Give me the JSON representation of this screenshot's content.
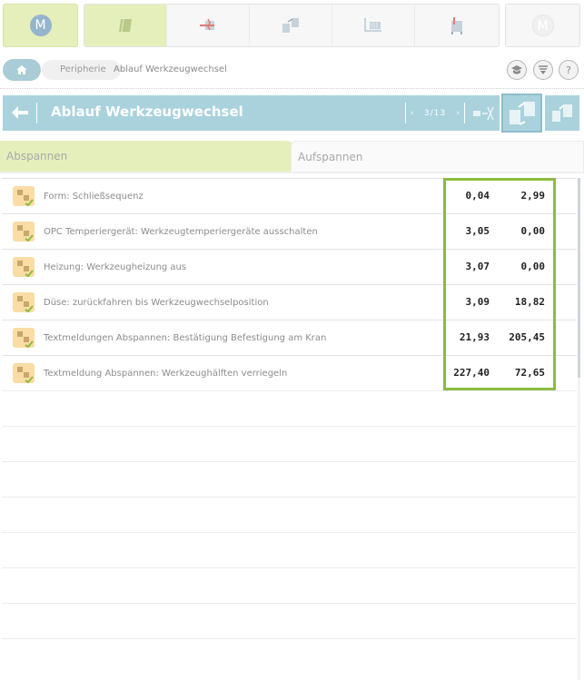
{
  "nav": {
    "left_badge": "M",
    "right_badge": "M",
    "icons": [
      "tool-icon",
      "heater-icon",
      "mold-change-icon",
      "robot-icon",
      "sequence-icon"
    ],
    "active_index": 0
  },
  "breadcrumb": {
    "items": [
      "Peripherie",
      "Ablauf Werkzeugwechsel"
    ],
    "buttons": [
      "graduation-cap-icon",
      "filter-icon",
      "help-icon"
    ],
    "help_label": "?"
  },
  "title": {
    "text": "Ablauf Werkzeugwechsel",
    "page": "3/13"
  },
  "tabs": [
    "Abspannen",
    "Aufspannen"
  ],
  "rows": [
    {
      "label": "Form: Schließsequenz",
      "a": "0,04",
      "b": "2,99"
    },
    {
      "label": "OPC Temperiergerät: Werkzeugtemperiergeräte ausschalten",
      "a": "3,05",
      "b": "0,00"
    },
    {
      "label": "Heizung: Werkzeugheizung aus",
      "a": "3,07",
      "b": "0,00"
    },
    {
      "label": "Düse: zurückfahren bis Werkzeugwechselposition",
      "a": "3,09",
      "b": "18,82"
    },
    {
      "label": "Textmeldungen Abspannen: Bestätigung Befestigung am Kran",
      "a": "21,93",
      "b": "205,45"
    },
    {
      "label": "Textmeldung Abspannen: Werkzeughälften verriegeln",
      "a": "227,40",
      "b": "72,65"
    }
  ],
  "colors": {
    "title_bar": "#a9d2dd",
    "active_tab": "#e5efbc",
    "highlight": "#8dbb3e"
  }
}
